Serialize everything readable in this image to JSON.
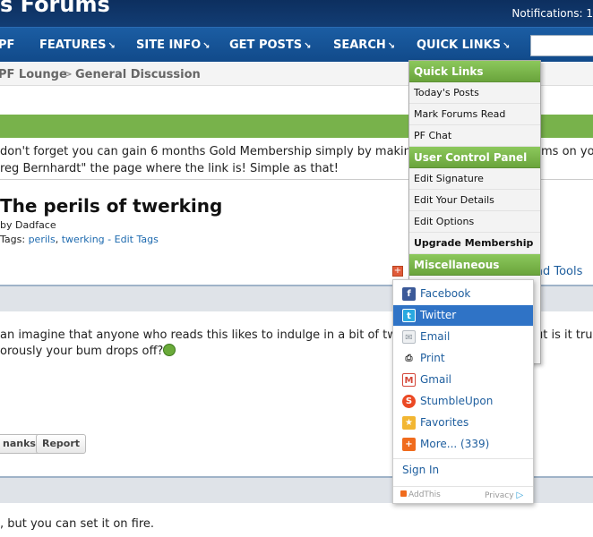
{
  "header": {
    "site_title": "s Forums",
    "notifications": "Notifications: 1"
  },
  "nav": {
    "items": [
      {
        "label": "PF",
        "arrow": ""
      },
      {
        "label": "FEATURES",
        "arrow": "↘"
      },
      {
        "label": "SITE INFO",
        "arrow": "↘"
      },
      {
        "label": "GET POSTS",
        "arrow": "↘"
      },
      {
        "label": "SEARCH",
        "arrow": "↘"
      },
      {
        "label": "QUICK LINKS",
        "arrow": "↘"
      }
    ]
  },
  "breadcrumb": {
    "items": [
      "PF Lounge",
      "General Discussion"
    ],
    "separator": ">"
  },
  "notice": {
    "line1": "don't forget you can gain 6 months Gold Membership simply by making",
    "line1_tail": "ms on yo",
    "line2": "reg Bernhardt\" the page where the link is! Simple as that!"
  },
  "thread": {
    "title": "The perils of twerking",
    "by_prefix": "by",
    "author": "Dadface",
    "tags_prefix": "Tags:",
    "tags": [
      "perils",
      "twerking"
    ],
    "edit_tags": "Edit Tags",
    "tools_label": "ad Tools"
  },
  "post": {
    "line1_start": "an imagine that anyone who reads this likes to indulge in a bit of tw",
    "line1_end": "ut is it tru",
    "line2": "orously your bum drops off?",
    "buttons": {
      "thanks": "nanks",
      "report": "Report"
    }
  },
  "post2": {
    "text": ", but you can set it on fire."
  },
  "quick_links_menu": {
    "sections": [
      {
        "title": "Quick Links",
        "items": [
          {
            "label": "Today's Posts",
            "bold": false
          },
          {
            "label": "Mark Forums Read",
            "bold": false
          },
          {
            "label": "PF Chat",
            "bold": false
          }
        ]
      },
      {
        "title": "User Control Panel",
        "items": [
          {
            "label": "Edit Signature",
            "bold": false
          },
          {
            "label": "Edit Your Details",
            "bold": false
          },
          {
            "label": "Edit Options",
            "bold": false
          },
          {
            "label": "Upgrade Membership",
            "bold": true
          }
        ]
      },
      {
        "title": "Miscellaneous",
        "items": []
      }
    ]
  },
  "share_popup": {
    "items": [
      {
        "label": "Facebook",
        "icon": "facebook-icon",
        "glyph": "f",
        "color": "#3b5998",
        "active": false
      },
      {
        "label": "Twitter",
        "icon": "twitter-icon",
        "glyph": "t",
        "color": "#2aa9e0",
        "active": true
      },
      {
        "label": "Email",
        "icon": "email-icon",
        "glyph": "✉",
        "color": "#9aa3ad",
        "active": false
      },
      {
        "label": "Print",
        "icon": "print-icon",
        "glyph": "⎙",
        "color": "#555555",
        "active": false
      },
      {
        "label": "Gmail",
        "icon": "gmail-icon",
        "glyph": "M",
        "color": "#d44638",
        "active": false
      },
      {
        "label": "StumbleUpon",
        "icon": "stumbleupon-icon",
        "glyph": "S",
        "color": "#eb4924",
        "active": false
      },
      {
        "label": "Favorites",
        "icon": "favorites-icon",
        "glyph": "★",
        "color": "#f2b632",
        "active": false
      },
      {
        "label": "More... (339)",
        "icon": "more-icon",
        "glyph": "+",
        "color": "#f06b1d",
        "active": false
      }
    ],
    "sign_in": "Sign In",
    "brand": "AddThis",
    "privacy": "Privacy"
  }
}
